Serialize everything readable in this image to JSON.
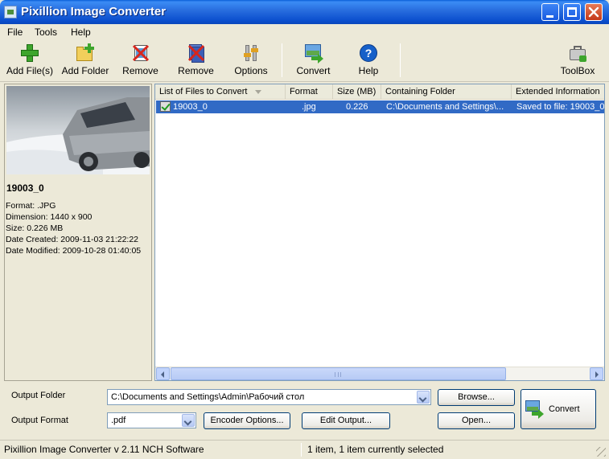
{
  "window": {
    "title": "Pixillion Image Converter"
  },
  "menu": [
    "File",
    "Tools",
    "Help"
  ],
  "toolbar": {
    "add_files": "Add File(s)",
    "add_folder": "Add Folder",
    "remove1": "Remove",
    "remove2": "Remove",
    "options": "Options",
    "convert": "Convert",
    "help": "Help",
    "toolbox": "ToolBox"
  },
  "preview": {
    "name": "19003_0",
    "format": "Format: .JPG",
    "dimension": "Dimension: 1440 x 900",
    "size": "Size: 0.226 MB",
    "created": "Date Created: 2009-11-03 21:22:22",
    "modified": "Date Modified: 2009-10-28 01:40:05"
  },
  "list": {
    "columns": [
      "List of Files to Convert",
      "Format",
      "Size (MB)",
      "Containing Folder",
      "Extended Information"
    ],
    "rows": [
      {
        "name": "19003_0",
        "format": ".jpg",
        "size": "0.226",
        "folder": "C:\\Documents and Settings\\...",
        "info": "Saved to file: 19003_0"
      }
    ]
  },
  "output": {
    "folder_label": "Output Folder",
    "folder_value": "C:\\Documents and Settings\\Admin\\Рабочий стол",
    "format_label": "Output Format",
    "format_value": ".pdf",
    "browse": "Browse...",
    "open": "Open...",
    "encoder_options": "Encoder Options...",
    "edit_output": "Edit Output...",
    "convert": "Convert"
  },
  "status": {
    "left": "Pixillion Image Converter v 2.11  NCH Software",
    "right": "1 item, 1 item currently selected"
  },
  "colors": {
    "title_bar": "#0b4fce",
    "selection": "#316ac5",
    "convert_green": "#3da52c"
  }
}
